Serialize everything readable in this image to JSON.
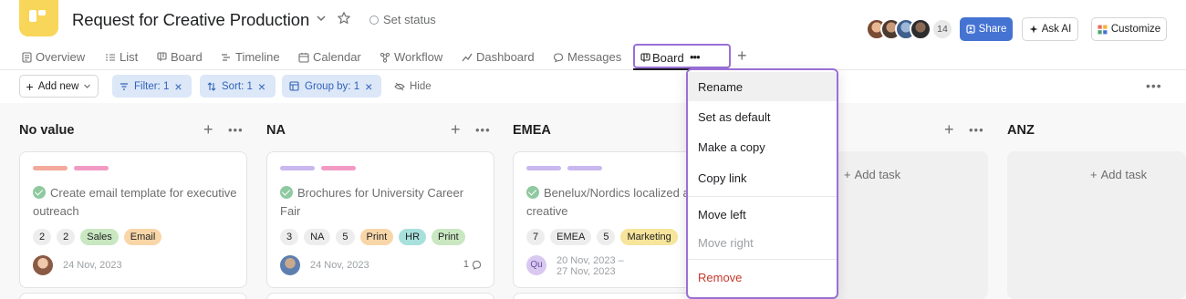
{
  "project": {
    "title": "Request for Creative Production",
    "set_status": "Set status",
    "member_count": "14"
  },
  "header_actions": {
    "share": "Share",
    "ask_ai": "Ask AI",
    "customize": "Customize"
  },
  "tabs": [
    {
      "label": "Overview",
      "icon": "overview-icon"
    },
    {
      "label": "List",
      "icon": "list-icon"
    },
    {
      "label": "Board",
      "icon": "board-icon"
    },
    {
      "label": "Timeline",
      "icon": "timeline-icon"
    },
    {
      "label": "Calendar",
      "icon": "calendar-icon"
    },
    {
      "label": "Workflow",
      "icon": "workflow-icon"
    },
    {
      "label": "Dashboard",
      "icon": "dashboard-icon"
    },
    {
      "label": "Messages",
      "icon": "messages-icon"
    },
    {
      "label": "Board",
      "icon": "board-icon",
      "active": true
    }
  ],
  "toolbar": {
    "add_new": "Add new",
    "filter": "Filter: 1",
    "sort": "Sort: 1",
    "group_by": "Group by: 1",
    "hide": "Hide"
  },
  "columns": [
    {
      "name": "No value",
      "card": {
        "title": "Create email template for executive outreach",
        "tags": [
          "2",
          "2",
          "Sales",
          "Email"
        ],
        "date": "24 Nov, 2023"
      }
    },
    {
      "name": "NA",
      "card": {
        "title": "Brochures for University Career Fair",
        "tags": [
          "3",
          "NA",
          "5",
          "Print",
          "HR",
          "Print"
        ],
        "date": "24 Nov, 2023",
        "comments": "1"
      }
    },
    {
      "name": "EMEA",
      "card": {
        "title_visible": "Benelux/Nordics localized a",
        "title_line2": "creative",
        "tags": [
          "7",
          "EMEA",
          "5",
          "Marketing"
        ],
        "date_line1": "20 Nov, 2023 –",
        "date_line2": "27 Nov, 2023",
        "assignee_initials": "Qu"
      }
    },
    {
      "name": "",
      "add_task": "Add task"
    },
    {
      "name": "ANZ",
      "add_task": "Add task"
    }
  ],
  "context_menu": {
    "items": [
      {
        "label": "Rename",
        "state": "hover"
      },
      {
        "label": "Set as default"
      },
      {
        "label": "Make a copy"
      },
      {
        "label": "Copy link"
      },
      {
        "label": "Move left"
      },
      {
        "label": "Move right",
        "state": "disabled"
      },
      {
        "label": "Remove",
        "state": "danger"
      }
    ]
  },
  "colors": {
    "accent_blue": "#4573d2",
    "menu_outline": "#9b6fd6",
    "logo_yellow": "#f8d65a",
    "danger": "#c9372c"
  }
}
